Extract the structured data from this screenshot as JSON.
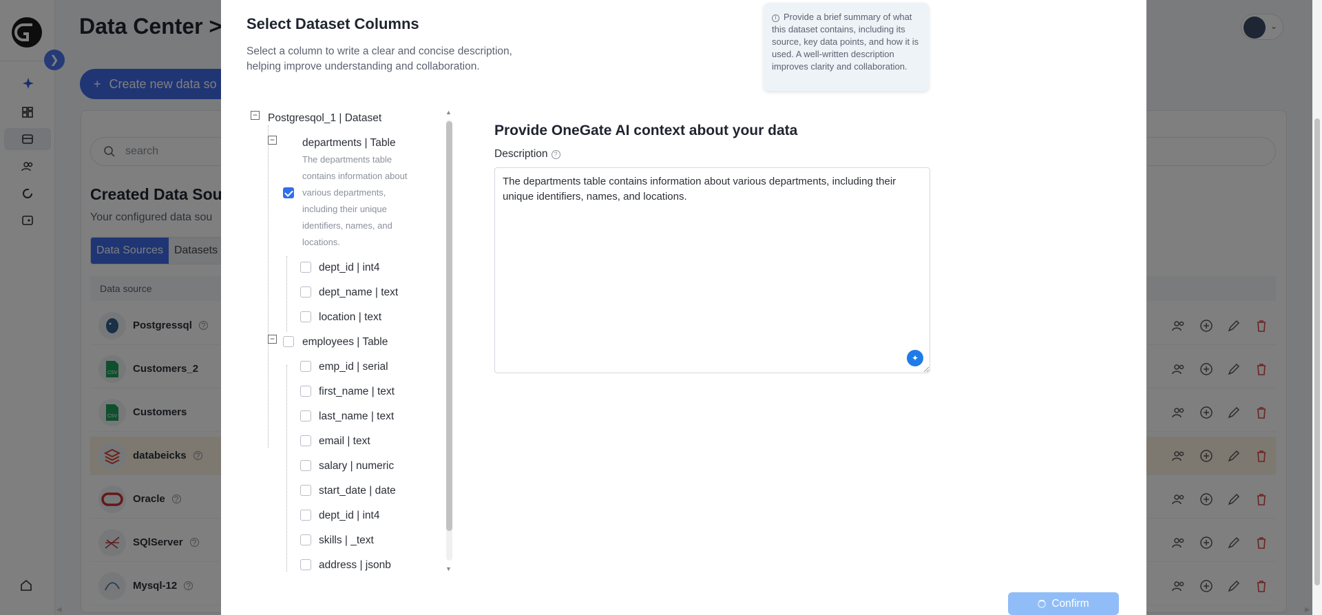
{
  "app": {
    "page_title": "Data Center > D",
    "create_button": "Create new data so",
    "search_placeholder": "search",
    "section_title": "Created Data Sou",
    "section_subtitle": "Your configured data sou",
    "tabs": [
      "Data Sources",
      "Datasets"
    ],
    "table_header": "Data source",
    "rows": [
      {
        "name": "Postgressql",
        "icon": "postgres-icon",
        "has_help": true
      },
      {
        "name": "Customers_2",
        "icon": "csv-icon",
        "has_help": false
      },
      {
        "name": "Customers",
        "icon": "csv-icon",
        "has_help": false
      },
      {
        "name": "databeicks",
        "icon": "databricks-icon",
        "has_help": true
      },
      {
        "name": "Oracle",
        "icon": "oracle-icon",
        "has_help": true
      },
      {
        "name": "SQlServer",
        "icon": "sqlserver-icon",
        "has_help": true
      },
      {
        "name": "Mysql-12",
        "icon": "mysql-icon",
        "has_help": true
      }
    ]
  },
  "modal": {
    "title": "Select Dataset Columns",
    "subtitle": "Select a column to write a clear and concise description, helping improve understanding and collaboration.",
    "tip": "Provide a brief summary of what this dataset contains, including its source, key data points, and how it is used. A well-written description improves clarity and collaboration.",
    "tree": {
      "root": "Postgresqol_1 | Dataset",
      "tables": [
        {
          "label": "departments | Table",
          "checked": true,
          "description": "The departments table contains information about various departments, including their unique identifiers, names, and locations.",
          "columns": [
            {
              "label": "dept_id | int4",
              "checked": false
            },
            {
              "label": "dept_name | text",
              "checked": false
            },
            {
              "label": "location | text",
              "checked": false
            }
          ]
        },
        {
          "label": "employees | Table",
          "checked": false,
          "columns": [
            {
              "label": "emp_id | serial",
              "checked": false
            },
            {
              "label": "first_name | text",
              "checked": false
            },
            {
              "label": "last_name | text",
              "checked": false
            },
            {
              "label": "email | text",
              "checked": false
            },
            {
              "label": "salary | numeric",
              "checked": false
            },
            {
              "label": "start_date | date",
              "checked": false
            },
            {
              "label": "dept_id | int4",
              "checked": false
            },
            {
              "label": "skills | _text",
              "checked": false
            },
            {
              "label": "address | jsonb",
              "checked": false
            }
          ]
        }
      ]
    },
    "context_title": "Provide OneGate AI context about your data",
    "description_label": "Description",
    "description_value": "The departments table contains information about various departments, including their unique identifiers, names, and locations.",
    "confirm_label": "Confirm"
  },
  "colors": {
    "accent": "#3f6ae8",
    "checkbox_checked": "#2f6fed",
    "confirm_disabled": "#90bdf7",
    "delete_red": "#d64545",
    "highlight_row": "#fbf3e3"
  }
}
